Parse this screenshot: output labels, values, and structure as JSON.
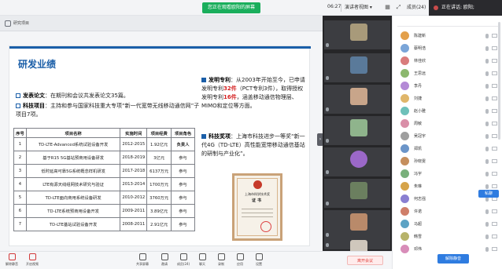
{
  "topbar": {
    "banner": "您正在观看欧阳的屏幕",
    "time": "06:27",
    "mode_label": "演讲者视图",
    "members_label": "成员(24)",
    "speaking": "正在讲话: 欧阳;"
  },
  "share": {
    "header_title": "研究项目"
  },
  "slide": {
    "heading": "研发业绩",
    "left_b1_label": "发表论文",
    "left_b1_text": "：在期刊和会议共发表论文35篇。",
    "left_b2_label": "科技项目",
    "left_b2_text": "：主持和参与国家科技重大专项“新一代宽带无线移动通信网”子项目7项。",
    "right_b1_label": "发明专利",
    "right_b1_text_a": "：从2003年开始至今，已申请发明专利",
    "right_b1_red1": "32件",
    "right_b1_text_b": "（PCT专利3件），取得授权发明专利",
    "right_b1_red2": "16件",
    "right_b1_text_c": "，涵盖移动通信物理层、MIMO和定位等方面。",
    "right_b2_label": "科技奖项",
    "right_b2_text": "：上海市科技进步一等奖“新一代4G（TD-LTE）高性能宽带移动通信基站的研制与产业化”。",
    "table": {
      "headers": [
        "序号",
        "项目名称",
        "实施时间",
        "项目经费",
        "项目角色"
      ],
      "rows": [
        [
          "1",
          "TD-LTE-Advanced系统试验设备开发",
          "2012-2015",
          "1.92亿元",
          "负责人"
        ],
        [
          "2",
          "基于R15 5G基站预商用设备研发",
          "2018-2019",
          "3亿元",
          "参与"
        ],
        [
          "3",
          "低时延高可靠5G系统概念样机研发",
          "2017-2018",
          "6137万元",
          "参与"
        ],
        [
          "4",
          "LTE有源天线组网技术研究与验证",
          "2013-2014",
          "1700万元",
          "参与"
        ],
        [
          "5",
          "TD-LTE面向商用系统设备研发",
          "2010-2012",
          "3760万元",
          "参与"
        ],
        [
          "6",
          "TD-LTE系统预商用设备开发",
          "2009-2011",
          "3.89亿元",
          "参与"
        ],
        [
          "7",
          "TD-LTE基站试验设备开发",
          "2008-2011",
          "2.91亿元",
          "参与"
        ]
      ]
    },
    "cert": {
      "org": "上海市科学技术奖",
      "title": "证书"
    }
  },
  "videos": [
    {
      "name": "",
      "color": "#a89a7a"
    },
    {
      "name": "",
      "color": "#5a7a9a"
    },
    {
      "name": "",
      "color": "#c8a58a"
    },
    {
      "name": "",
      "color": "#8fb48c"
    },
    {
      "name": "",
      "color": "#9b68c8"
    },
    {
      "name": "",
      "color": "#6b7f5f"
    },
    {
      "name": "",
      "color": "#b98a6a"
    },
    {
      "name": "",
      "color": "#cfc7bc"
    }
  ],
  "members": [
    {
      "name": "陈建新",
      "color": "#e3a04b"
    },
    {
      "name": "蔡明浩",
      "color": "#7aa5d8"
    },
    {
      "name": "林佳欣",
      "color": "#d97c7c"
    },
    {
      "name": "王思远",
      "color": "#8cb86e"
    },
    {
      "name": "李丹",
      "color": "#b48ad6"
    },
    {
      "name": "刘捷",
      "color": "#e0b66a"
    },
    {
      "name": "赵小雅",
      "color": "#6ec0b9"
    },
    {
      "name": "周敏",
      "color": "#d98fa8"
    },
    {
      "name": "吴冠宇",
      "color": "#9f9f9f"
    },
    {
      "name": "郑凯",
      "color": "#6b95c9"
    },
    {
      "name": "孙晓雯",
      "color": "#c58f5e"
    },
    {
      "name": "冯宇",
      "color": "#79b07b"
    },
    {
      "name": "朱琳",
      "color": "#d6a44a"
    },
    {
      "name": "何志强",
      "color": "#8a7fd1"
    },
    {
      "name": "许诺",
      "color": "#cf7f6a"
    },
    {
      "name": "马超",
      "color": "#5da3c4"
    },
    {
      "name": "韩雪",
      "color": "#b7b36a"
    },
    {
      "name": "邓伟",
      "color": "#d88db9"
    }
  ],
  "member_panel": {
    "hand_label": "私聊",
    "mute_all_label": "解除静音"
  },
  "toolbar": {
    "buttons": [
      "解除静音",
      "开启视频",
      "共享屏幕",
      "邀请",
      "成员(24)",
      "聊天",
      "录制",
      "应用",
      "设置"
    ],
    "leave_label": "离开会议"
  }
}
